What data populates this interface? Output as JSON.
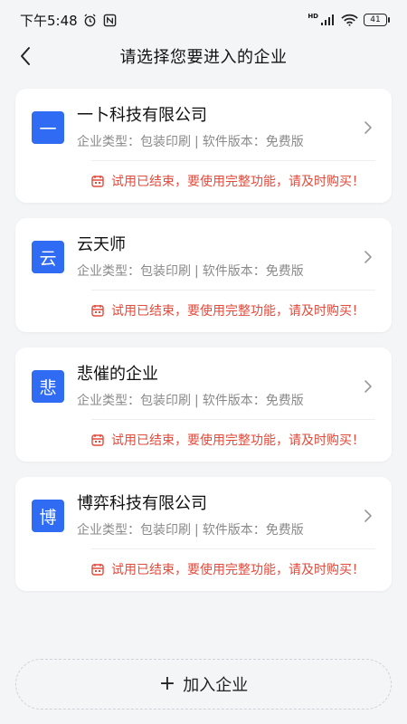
{
  "status_bar": {
    "time": "下午5:48",
    "battery": "41",
    "network_label": "HD"
  },
  "header": {
    "title": "请选择您要进入的企业"
  },
  "companies": [
    {
      "avatar": "一",
      "name": "一卜科技有限公司",
      "type_label": "企业类型：",
      "type_value": "包装印刷",
      "version_label": "软件版本：",
      "version_value": "免费版",
      "trial_notice": "试用已结束，要使用完整功能，请及时购买！"
    },
    {
      "avatar": "云",
      "name": "云天师",
      "type_label": "企业类型：",
      "type_value": "包装印刷",
      "version_label": "软件版本：",
      "version_value": "免费版",
      "trial_notice": "试用已结束，要使用完整功能，请及时购买！"
    },
    {
      "avatar": "悲",
      "name": "悲催的企业",
      "type_label": "企业类型：",
      "type_value": "包装印刷",
      "version_label": "软件版本：",
      "version_value": "免费版",
      "trial_notice": "试用已结束，要使用完整功能，请及时购买！"
    },
    {
      "avatar": "博",
      "name": "博弈科技有限公司",
      "type_label": "企业类型：",
      "type_value": "包装印刷",
      "version_label": "软件版本：",
      "version_value": "免费版",
      "trial_notice": "试用已结束，要使用完整功能，请及时购买！"
    }
  ],
  "separator": "|",
  "join_button": {
    "icon": "+",
    "label": "加入企业"
  },
  "colors": {
    "accent": "#2f6bf3",
    "warning": "#e24a3b",
    "background": "#f4f5f7"
  }
}
